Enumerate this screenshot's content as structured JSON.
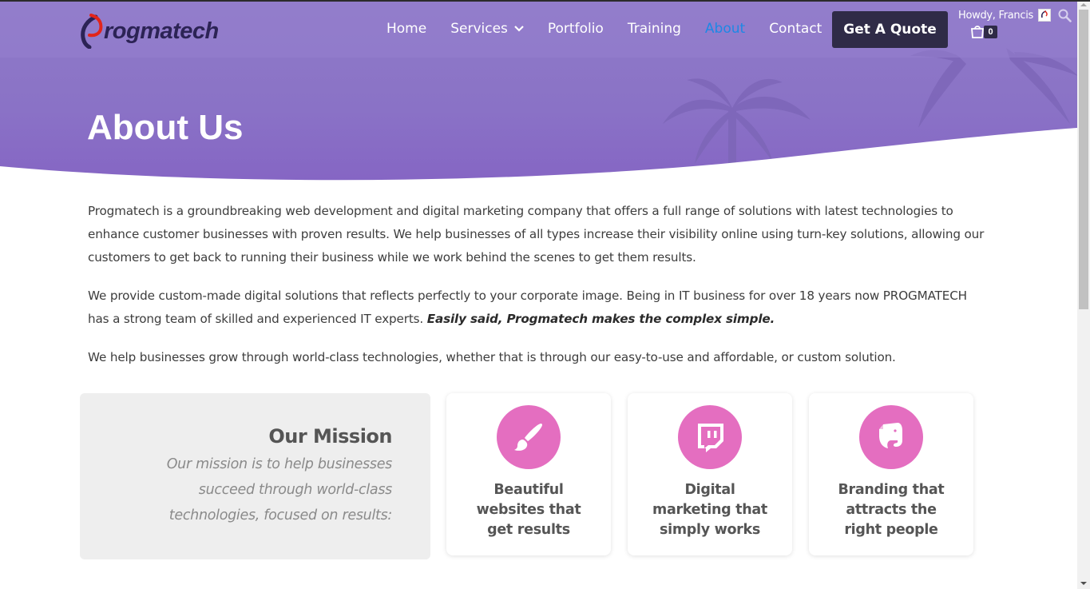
{
  "brand": {
    "logo_text": "rogmatech",
    "accent": "#e2251b"
  },
  "nav": {
    "items": [
      {
        "label": "Home",
        "active": false
      },
      {
        "label": "Services",
        "active": false,
        "dropdown": true
      },
      {
        "label": "Portfolio",
        "active": false
      },
      {
        "label": "Training",
        "active": false
      },
      {
        "label": "About",
        "active": true
      },
      {
        "label": "Contact",
        "active": false
      }
    ],
    "cta": "Get A Quote"
  },
  "account": {
    "greeting": "Howdy, Francis",
    "cart_count": "0"
  },
  "page": {
    "title": "About Us"
  },
  "content": {
    "p1": "Progmatech is a groundbreaking web development and digital marketing company that offers a full range of solutions with latest technologies to enhance customer businesses with proven results. We help businesses of all types increase their visibility online using turn-key solutions, allowing our customers to get back to running their business while we work behind the scenes to get them results.",
    "p2": "We provide custom-made digital solutions that reflects perfectly to your corporate image. Being in IT business for over 18 years now PROGMATECH has a strong team of skilled and experienced IT experts.",
    "p2_emphasis": "Easily said, Progmatech makes the complex simple.",
    "p3": "We help businesses grow through world-class technologies, whether that is through our easy-to-use and affordable, or custom solution."
  },
  "mission": {
    "title": "Our Mission",
    "text": "Our mission is to help businesses succeed through world-class technologies, focused on results:"
  },
  "features": [
    {
      "icon": "paintbrush-icon",
      "label": "Beautiful websites that get results"
    },
    {
      "icon": "twitch-icon",
      "label": "Digital marketing that simply works"
    },
    {
      "icon": "evernote-icon",
      "label": "Branding that attracts the right people"
    }
  ],
  "colors": {
    "hero": "#8a72c6",
    "cta_bg": "#2f2b47",
    "active_nav": "#1e88e5",
    "feature_icon_bg": "#e46ec0"
  }
}
